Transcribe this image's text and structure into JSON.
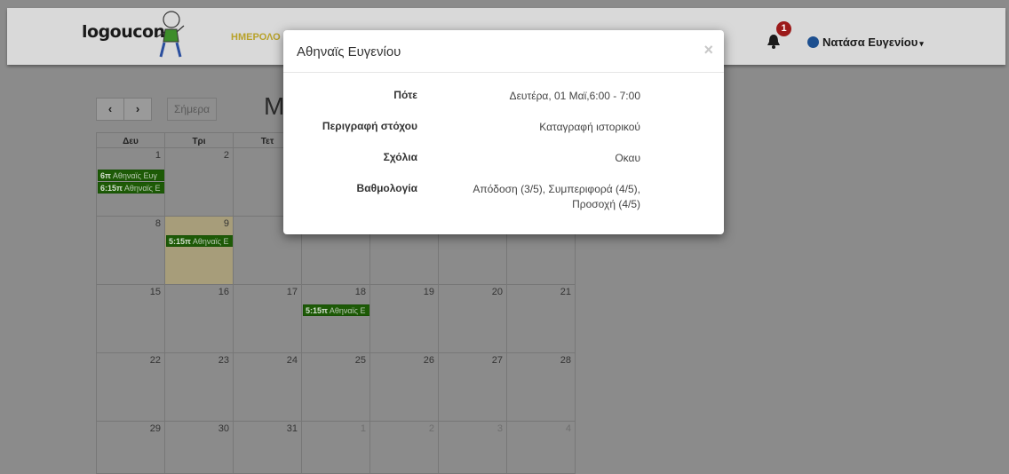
{
  "navbar": {
    "logo_text": "logoucon",
    "link_calendar": "ΗΜΕΡΟΛΟ",
    "notification_count": "1",
    "user_name": "Νατάσα Ευγενίου",
    "caret": "▾"
  },
  "toolbar": {
    "prev_label": "‹",
    "next_label": "›",
    "today_label": "Σήμερα",
    "title": "M"
  },
  "calendar": {
    "day_headers": [
      "Δευ",
      "Τρι",
      "Τετ"
    ],
    "weeks": [
      [
        "1",
        "2",
        "",
        "",
        "",
        "",
        ""
      ],
      [
        "8",
        "9",
        "",
        "",
        "",
        "",
        ""
      ],
      [
        "15",
        "16",
        "17",
        "18",
        "19",
        "20",
        "21"
      ],
      [
        "22",
        "23",
        "24",
        "25",
        "26",
        "27",
        "28"
      ],
      [
        "29",
        "30",
        "31",
        "1",
        "2",
        "3",
        "4"
      ]
    ],
    "events": [
      {
        "time": "6π",
        "title": "Αθηναϊς Ευγ"
      },
      {
        "time": "6:15π",
        "title": "Αθηναϊς Ε"
      },
      {
        "time": "5:15π",
        "title": "Αθηναϊς Ε"
      },
      {
        "time": "5:15π",
        "title": "Αθηναϊς Ε"
      }
    ]
  },
  "modal": {
    "title": "Αθηναϊς Ευγενίου",
    "close": "×",
    "rows": [
      {
        "label": "Πότε",
        "value": "Δευτέρα, 01 Μαϊ,6:00 - 7:00"
      },
      {
        "label": "Περιγραφή στόχου",
        "value": "Καταγραφή ιστορικού"
      },
      {
        "label": "Σχόλια",
        "value": "Οκαυ"
      },
      {
        "label": "Βαθμολογία",
        "value": "Απόδοση (3/5), Συμπεριφορά (4/5), Προσοχή (4/5)"
      }
    ]
  },
  "colors": {
    "event_bg": "#1d5a06",
    "highlight_day": "#a79d7a",
    "badge": "#9c1a1a",
    "overlay": "#8b8b8b"
  }
}
